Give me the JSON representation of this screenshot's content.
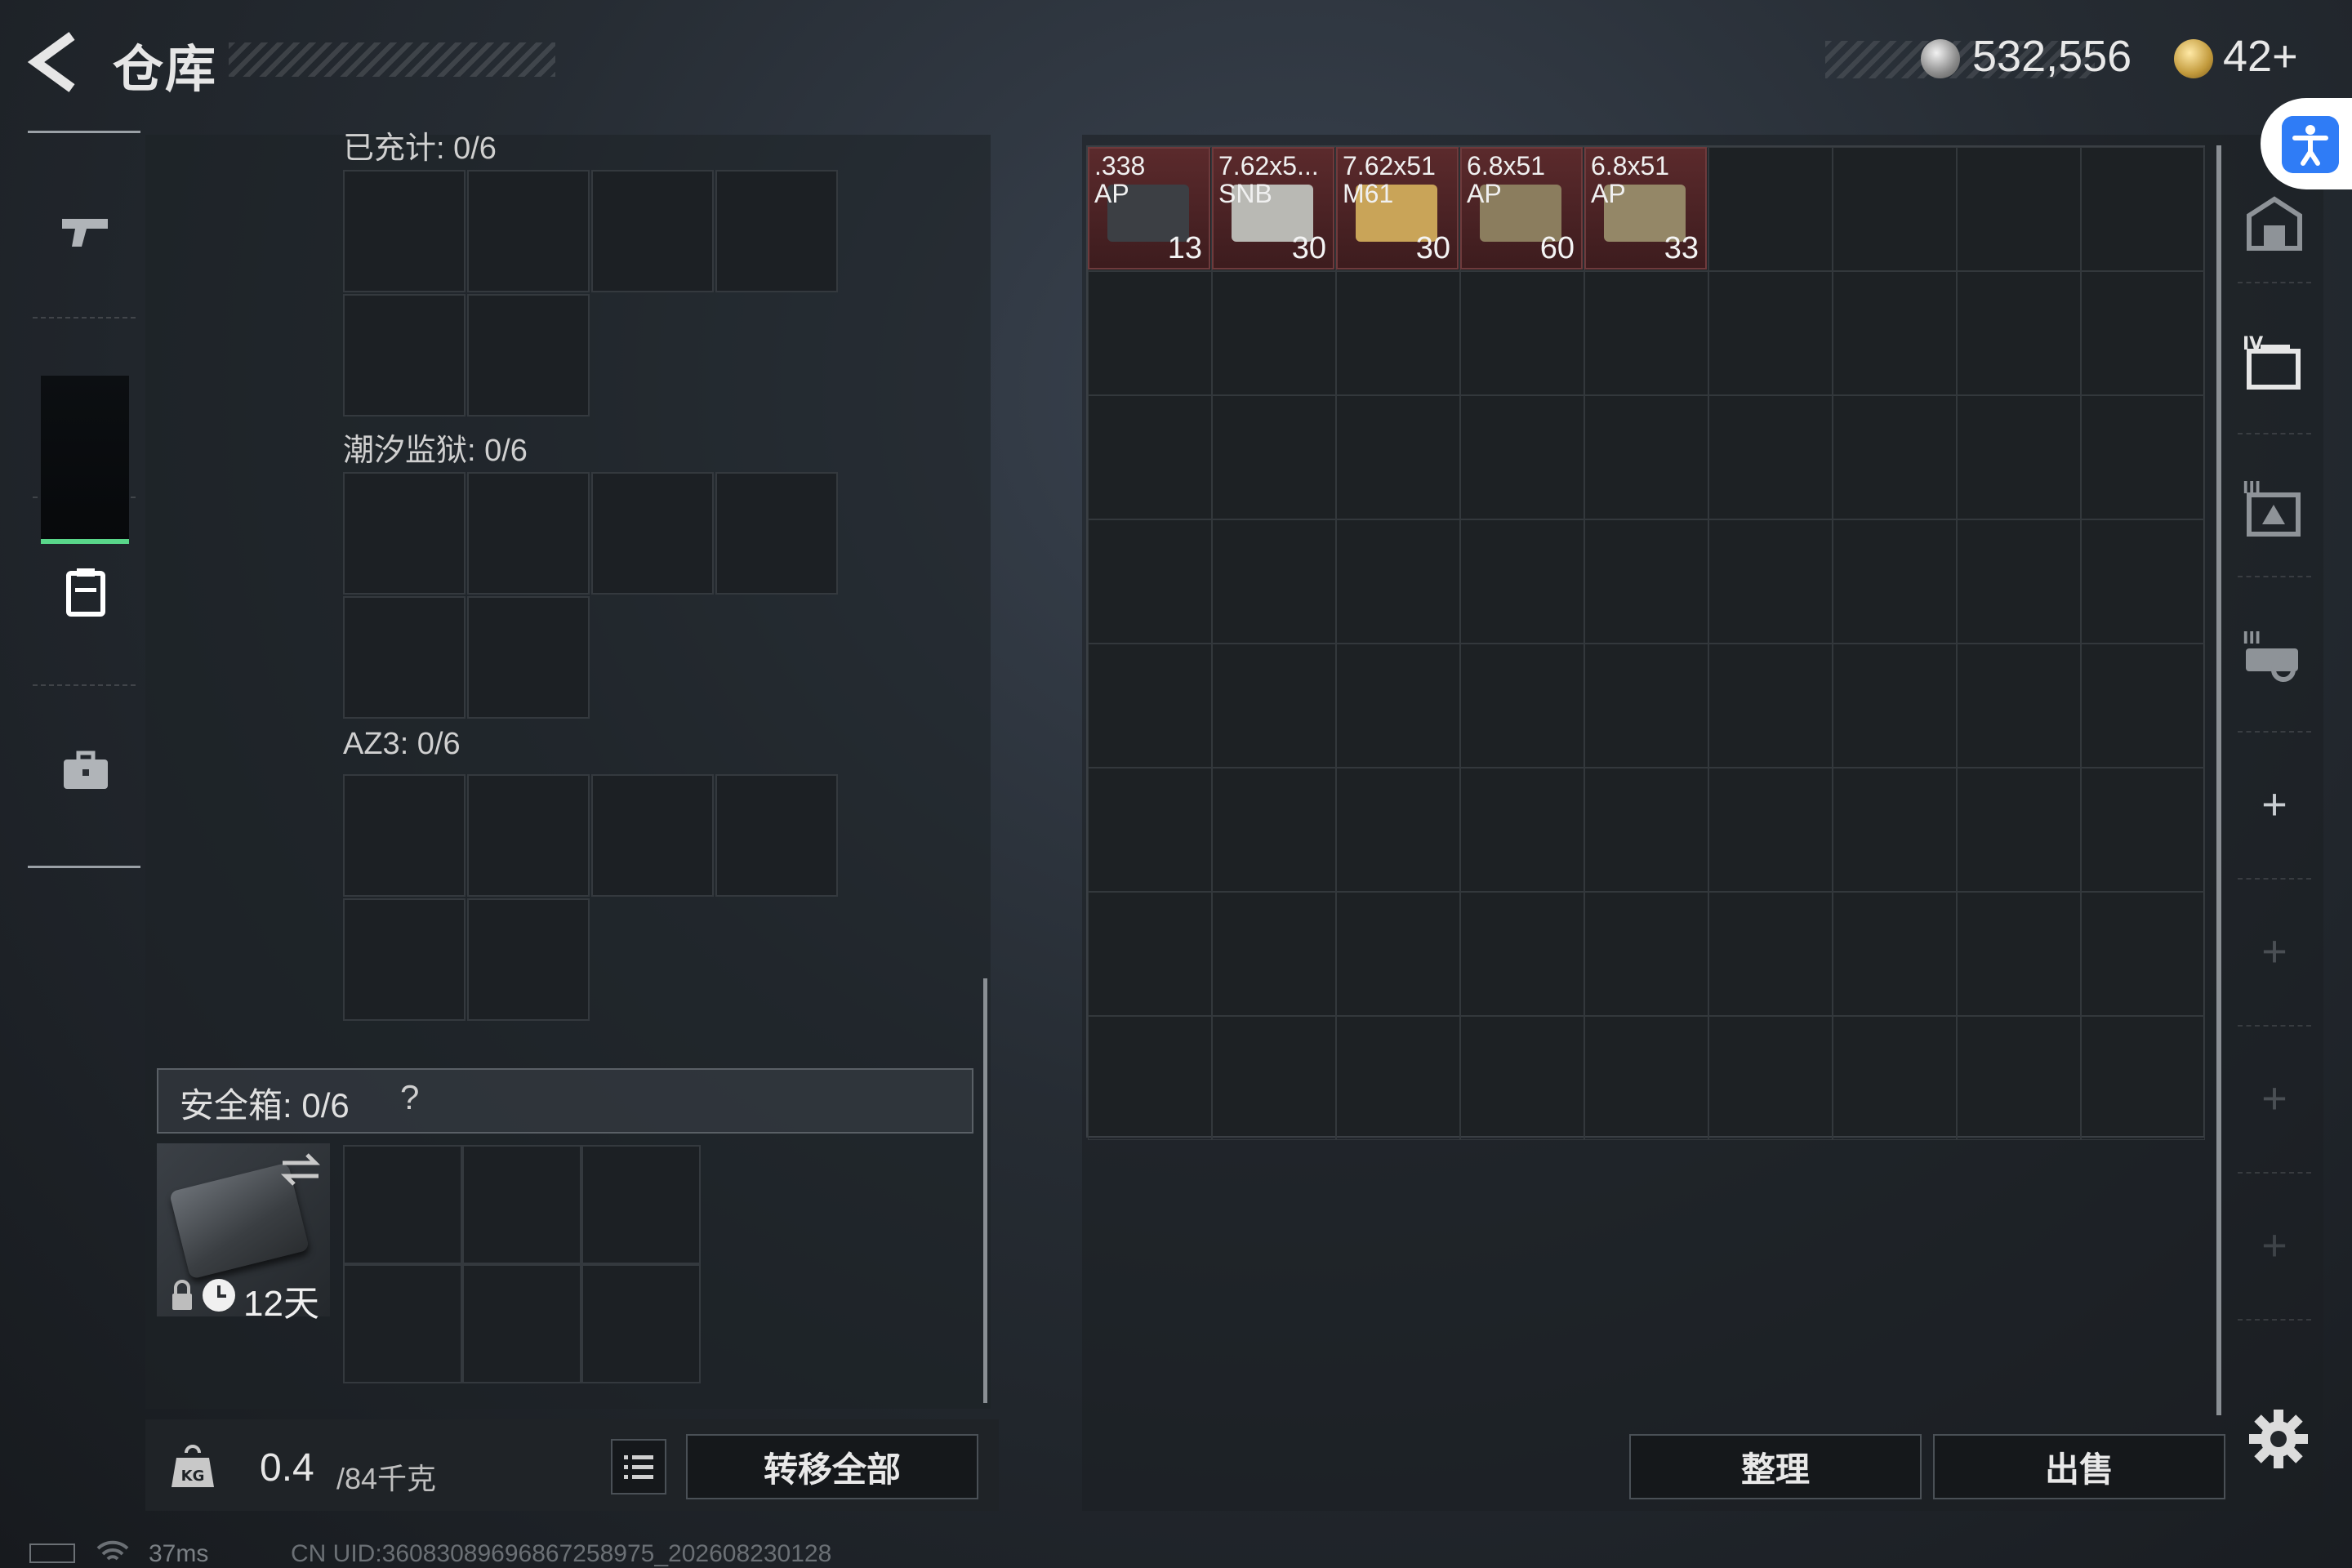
{
  "header": {
    "title": "仓库",
    "currency_silver": "532,556",
    "currency_gold": "42+"
  },
  "sections": [
    {
      "label": "已充计: 0/6"
    },
    {
      "label": "潮汐监狱: 0/6"
    },
    {
      "label": "AZ3: 0/6"
    }
  ],
  "safe_box": {
    "label": "安全箱: 0/6",
    "help": "?",
    "days_left": "12天"
  },
  "bottom_left": {
    "weight_current": "0.4",
    "weight_max": "/84千克",
    "transfer_all": "转移全部"
  },
  "storage_items": [
    {
      "name": ".338\nAP",
      "qty": "13",
      "box_color": "#3c3f44"
    },
    {
      "name": "7.62x5...\nSNB",
      "qty": "30",
      "box_color": "#b9b9b4"
    },
    {
      "name": "7.62x51\nM61",
      "qty": "30",
      "box_color": "#c9a458"
    },
    {
      "name": "6.8x51\nAP",
      "qty": "60",
      "box_color": "#8b7d5e"
    },
    {
      "name": "6.8x51\nAP",
      "qty": "33",
      "box_color": "#948767"
    }
  ],
  "buttons": {
    "sort": "整理",
    "sell": "出售"
  },
  "status": {
    "ping": "37ms",
    "uid": "CN UID:36083089696867258975_202608230128"
  },
  "colors": {
    "accent_green": "#59d68a",
    "item_bg": "#5b2a2c",
    "accessibility_blue": "#2f7cf6"
  }
}
